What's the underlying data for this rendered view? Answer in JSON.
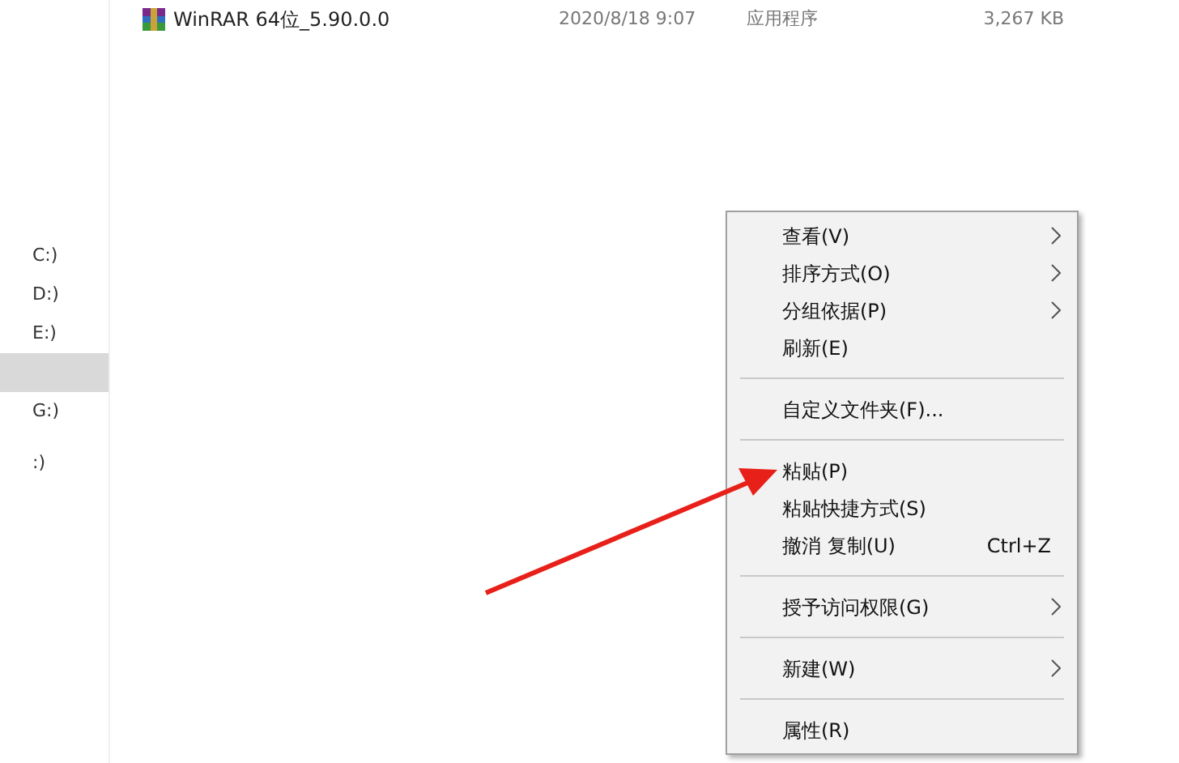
{
  "files": [
    {
      "name": "WinRAR 64位_5.90.0.0",
      "date": "2020/8/18 9:07",
      "type": "应用程序",
      "size": "3,267 KB"
    }
  ],
  "nav": {
    "groups": [
      [
        {
          "label": "C:)",
          "selected": false
        },
        {
          "label": "D:)",
          "selected": false
        },
        {
          "label": "E:)",
          "selected": false
        },
        {
          "selected": true
        },
        {
          "label": "G:)",
          "selected": false
        }
      ],
      [
        {
          "label": ":)",
          "selected": false
        }
      ]
    ]
  },
  "context_menu": [
    {
      "kind": "item",
      "label": "查看(V)",
      "submenu": true
    },
    {
      "kind": "item",
      "label": "排序方式(O)",
      "submenu": true
    },
    {
      "kind": "item",
      "label": "分组依据(P)",
      "submenu": true
    },
    {
      "kind": "item",
      "label": "刷新(E)",
      "submenu": false
    },
    {
      "kind": "separator"
    },
    {
      "kind": "item",
      "label": "自定义文件夹(F)...",
      "submenu": false
    },
    {
      "kind": "separator"
    },
    {
      "kind": "item",
      "label": "粘贴(P)",
      "submenu": false
    },
    {
      "kind": "item",
      "label": "粘贴快捷方式(S)",
      "submenu": false
    },
    {
      "kind": "item",
      "label": "撤消 复制(U)",
      "submenu": false,
      "shortcut": "Ctrl+Z"
    },
    {
      "kind": "separator"
    },
    {
      "kind": "item",
      "label": "授予访问权限(G)",
      "submenu": true
    },
    {
      "kind": "separator"
    },
    {
      "kind": "item",
      "label": "新建(W)",
      "submenu": true
    },
    {
      "kind": "separator"
    },
    {
      "kind": "item",
      "label": "属性(R)",
      "submenu": false
    }
  ]
}
